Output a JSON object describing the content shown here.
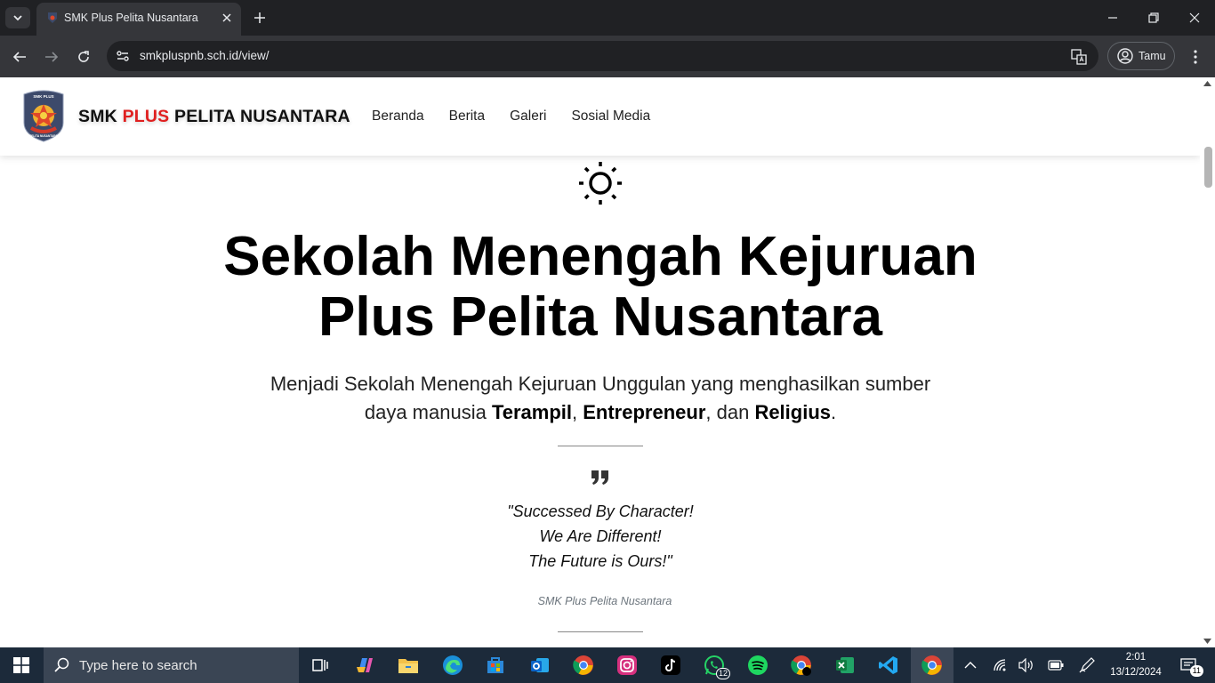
{
  "browser": {
    "tab_title": "SMK Plus Pelita Nusantara",
    "url": "smkpluspnb.sch.id/view/",
    "profile_label": "Tamu"
  },
  "site": {
    "brand_prefix": "SMK ",
    "brand_highlight": "PLUS",
    "brand_suffix": " PELITA NUSANTARA",
    "logo_text_top": "SMK PLUS",
    "logo_text_bottom": "PELITA NUSANTARA",
    "nav": [
      "Beranda",
      "Berita",
      "Galeri",
      "Sosial Media"
    ],
    "colors": {
      "accent": "#e02020",
      "text": "#111111"
    }
  },
  "hero": {
    "title_line1": "Sekolah Menengah Kejuruan",
    "title_line2": "Plus Pelita Nusantara",
    "lead_part1": "Menjadi Sekolah Menengah Kejuruan Unggulan yang menghasilkan sumber daya manusia ",
    "lead_bold1": "Terampil",
    "lead_sep1": ", ",
    "lead_bold2": "Entrepreneur",
    "lead_sep2": ", dan ",
    "lead_bold3": "Religius",
    "lead_end": "."
  },
  "quote": {
    "line1": "\"Successed By Character!",
    "line2": "We Are Different!",
    "line3": "The Future is Ours!\"",
    "cite": "SMK Plus Pelita Nusantara"
  },
  "taskbar": {
    "search_placeholder": "Type here to search",
    "whatsapp_badge": "12",
    "time": "2:01",
    "date": "13/12/2024",
    "notification_count": "11"
  }
}
